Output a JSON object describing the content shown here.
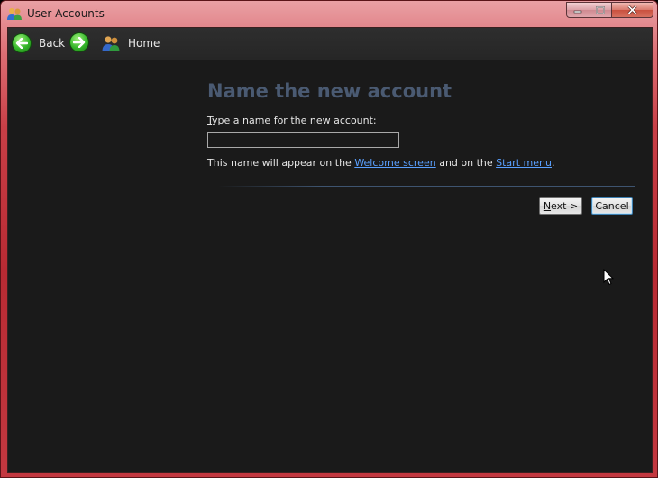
{
  "window": {
    "title": "User Accounts",
    "icon": "user-accounts-icon",
    "caption_buttons": [
      "minimize-icon",
      "maximize-icon",
      "close-icon"
    ]
  },
  "navbar": {
    "back_label": "Back",
    "home_label": "Home"
  },
  "form": {
    "heading": "Name the new account",
    "label_accel": "T",
    "label_rest": "ype a name for the new account:",
    "input_value": "",
    "info_before": "This name will appear on the ",
    "link_welcome": "Welcome screen",
    "info_middle": " and on the ",
    "link_start": "Start menu",
    "info_after": ".",
    "next_accel": "N",
    "next_rest": "ext >",
    "cancel_label": "Cancel"
  },
  "colors": {
    "heading": "#4a5a72",
    "link": "#5aa0ff",
    "background": "#1a1a1a",
    "frame": "#c93f47"
  }
}
